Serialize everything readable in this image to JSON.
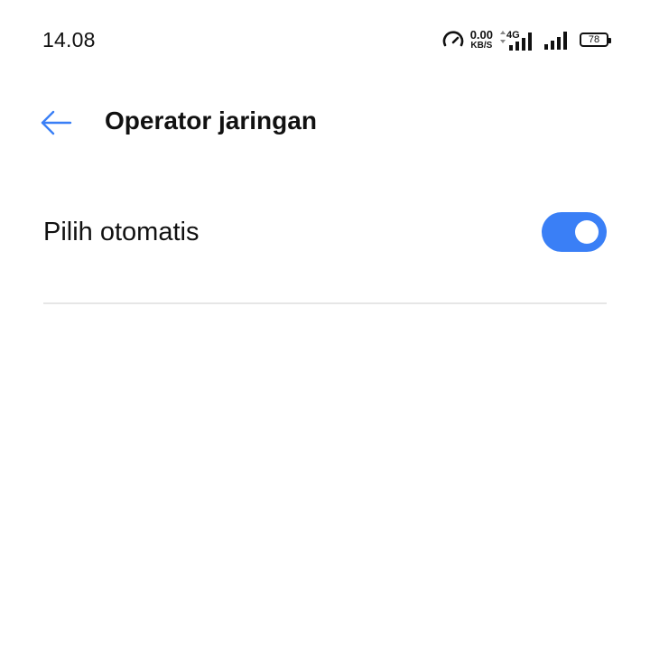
{
  "status_bar": {
    "time": "14.08",
    "net_speed_value": "0.00",
    "net_speed_unit": "KB/S",
    "network_type": "4G",
    "battery_level": "78",
    "icons": [
      "speedometer-icon",
      "data-arrows-icon",
      "signal-bars-icon",
      "signal-bars-2-icon",
      "battery-icon"
    ]
  },
  "header": {
    "title": "Operator jaringan",
    "back_icon": "back-arrow-icon"
  },
  "settings": {
    "auto_select": {
      "label": "Pilih otomatis",
      "enabled": true
    }
  },
  "colors": {
    "accent": "#3a7ff6",
    "text": "#111111",
    "divider": "#e6e6e6",
    "background": "#ffffff"
  }
}
